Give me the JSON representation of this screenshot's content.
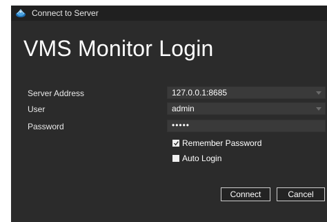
{
  "window": {
    "title": "Connect to Server",
    "icon": "server-globe-icon"
  },
  "heading": "VMS Monitor Login",
  "form": {
    "server_address": {
      "label": "Server Address",
      "value": "127.0.0.1:8685"
    },
    "user": {
      "label": "User",
      "value": "admin"
    },
    "password": {
      "label": "Password",
      "value": "•••••"
    }
  },
  "options": {
    "remember_password": {
      "label": "Remember Password",
      "checked": true
    },
    "auto_login": {
      "label": "Auto Login",
      "checked": false
    }
  },
  "buttons": {
    "connect": "Connect",
    "cancel": "Cancel"
  },
  "colors": {
    "window_bg": "#2b2b2b",
    "titlebar_bg": "#202020",
    "field_bg": "#3a3a3a"
  }
}
